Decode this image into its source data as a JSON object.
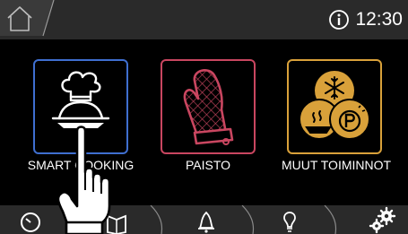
{
  "status_bar": {
    "time": "12:30",
    "home_icon": "home-icon",
    "info_icon": "info-icon"
  },
  "menu": {
    "tiles": [
      {
        "label": "SMART COOKING",
        "icon": "chef-cloche-icon",
        "color": "#3f6fd0"
      },
      {
        "label": "PAISTO",
        "icon": "oven-mitt-icon",
        "color": "#c94660"
      },
      {
        "label": "MUUT TOIMINNOT",
        "icon": "other-functions-icon",
        "color": "#d9a13a"
      }
    ]
  },
  "bottom_nav": {
    "items": [
      {
        "icon": "timer-icon"
      },
      {
        "icon": "recipe-book-icon"
      },
      {
        "icon": "bell-icon"
      },
      {
        "icon": "lightbulb-icon"
      },
      {
        "icon": "settings-icon"
      }
    ]
  },
  "overlay": {
    "icon": "pointing-hand-icon"
  }
}
